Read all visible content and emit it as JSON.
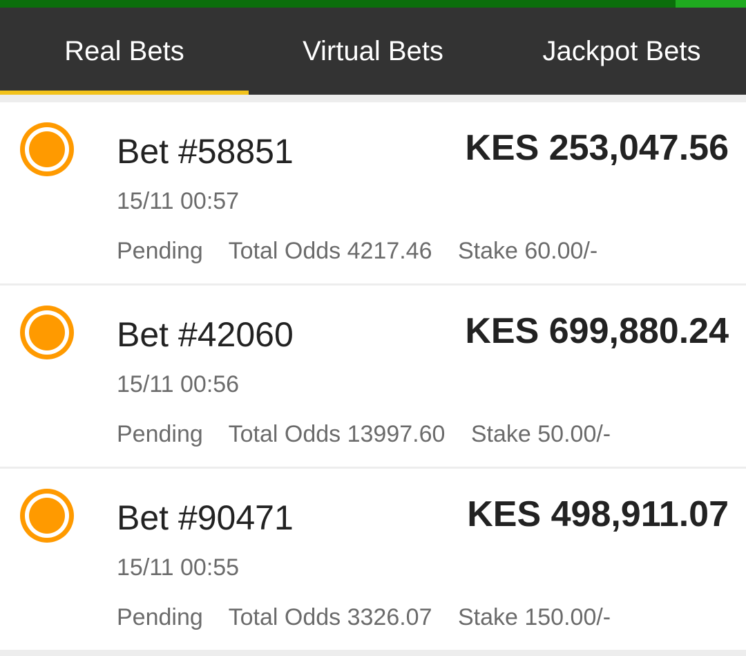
{
  "tabs": [
    {
      "label": "Real Bets",
      "active": true
    },
    {
      "label": "Virtual Bets",
      "active": false
    },
    {
      "label": "Jackpot Bets",
      "active": false
    }
  ],
  "bets": [
    {
      "id": "Bet #58851",
      "amount": "KES 253,047.56",
      "time": "15/11 00:57",
      "status": "Pending",
      "odds": "Total Odds 4217.46",
      "stake": "Stake 60.00/-"
    },
    {
      "id": "Bet #42060",
      "amount": "KES 699,880.24",
      "time": "15/11 00:56",
      "status": "Pending",
      "odds": "Total Odds 13997.60",
      "stake": "Stake 50.00/-"
    },
    {
      "id": "Bet #90471",
      "amount": "KES 498,911.07",
      "time": "15/11 00:55",
      "status": "Pending",
      "odds": "Total Odds 3326.07",
      "stake": "Stake 150.00/-"
    }
  ],
  "colors": {
    "tab_bar": "#333333",
    "tab_indicator": "#f2c21b",
    "status_pending": "#ff9a00",
    "top_strip": "#0b6e0b"
  }
}
